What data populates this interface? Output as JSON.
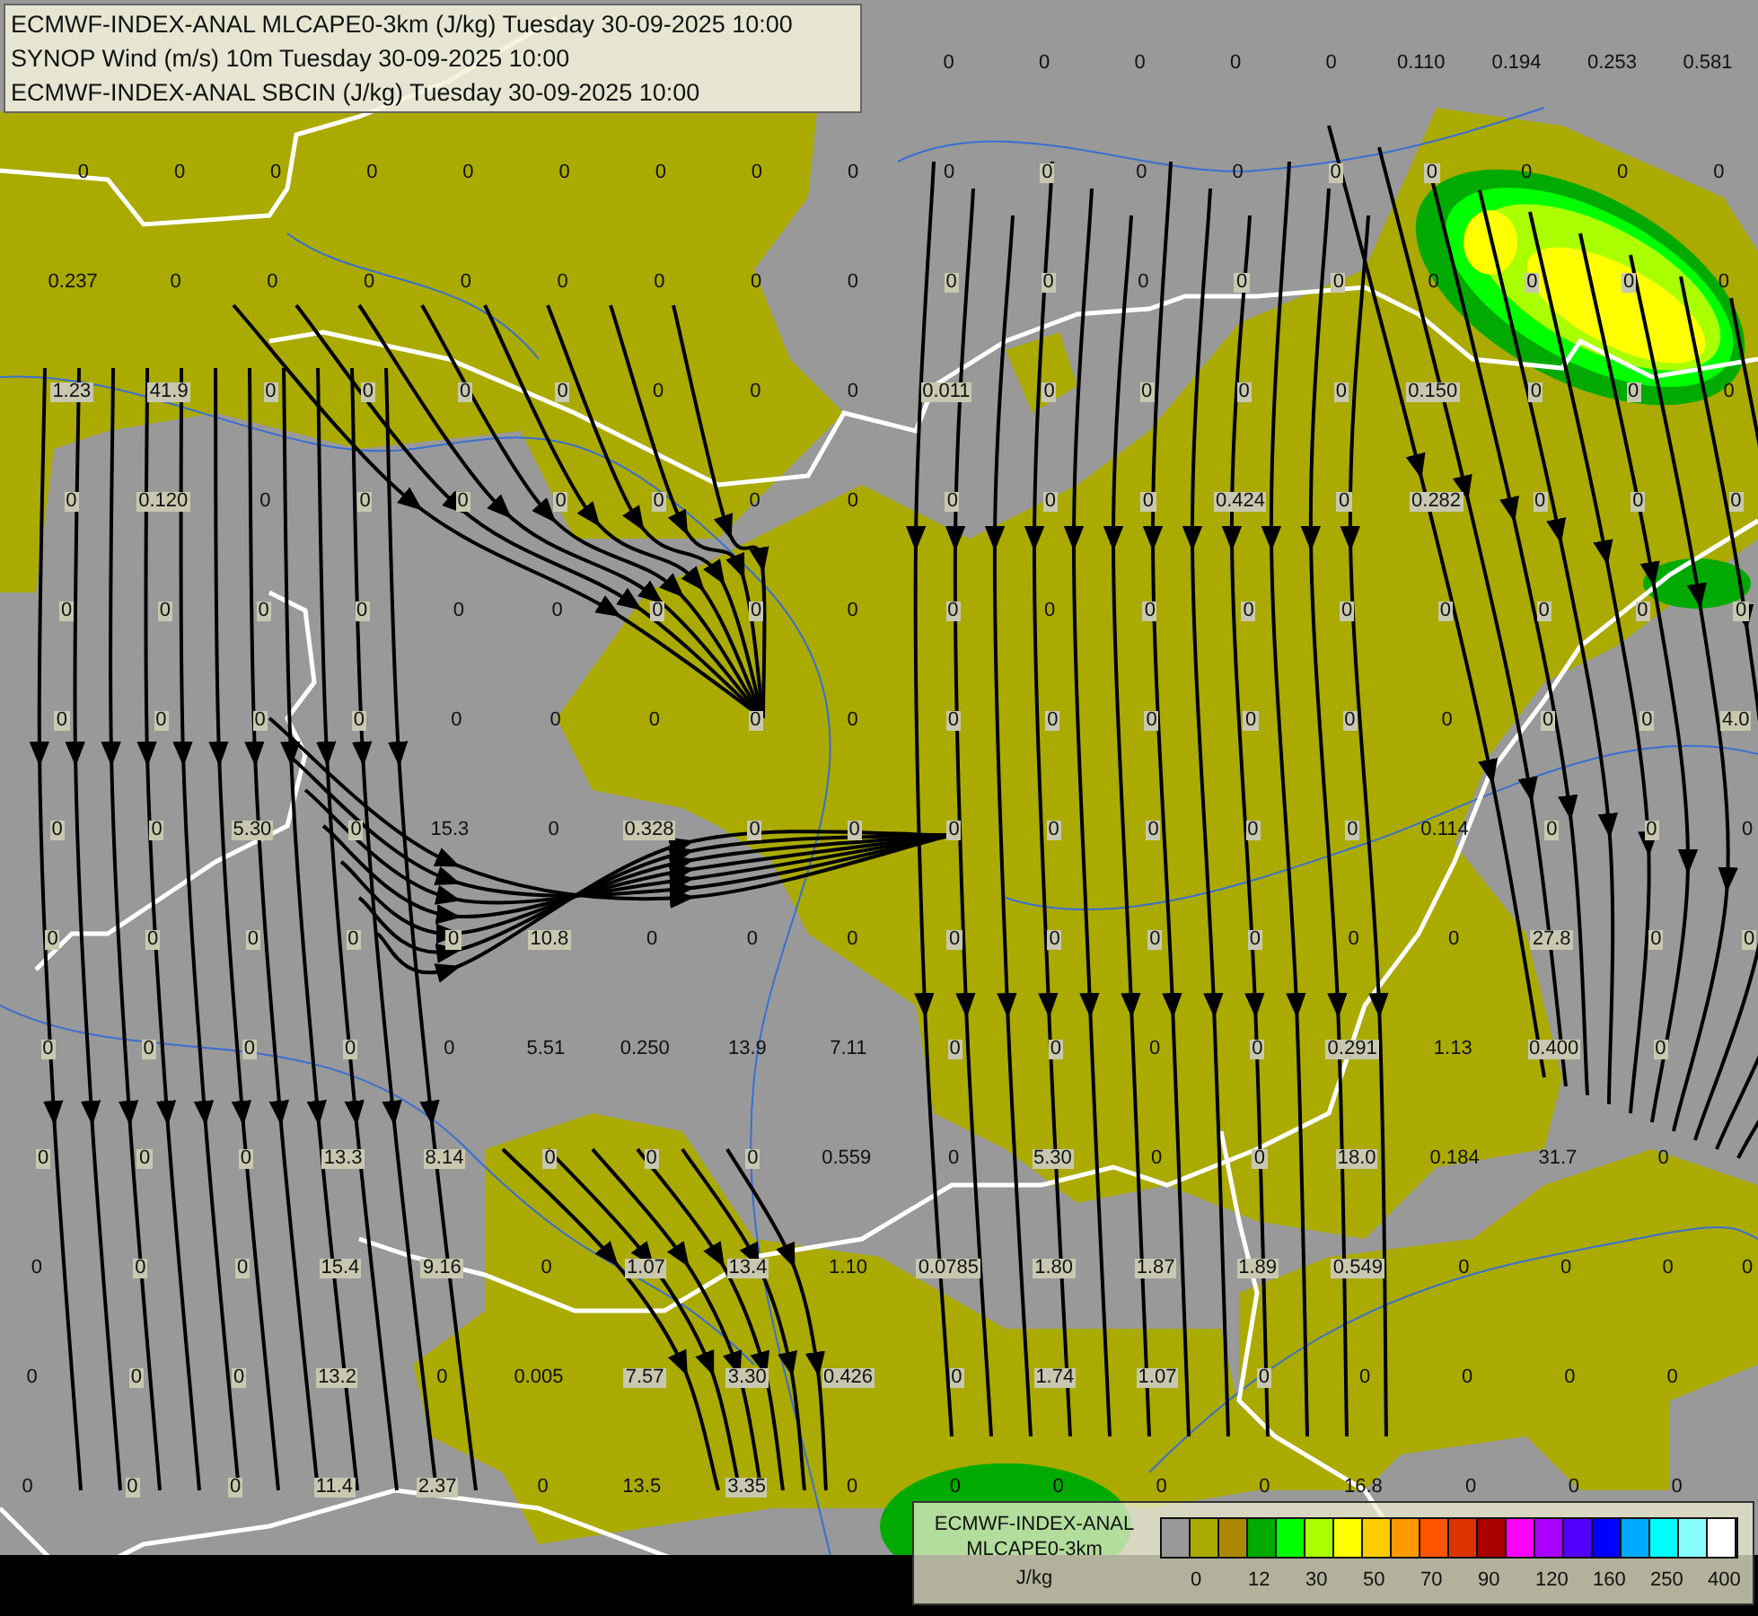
{
  "title_legend": {
    "lines": [
      "ECMWF-INDEX-ANAL MLCAPE0-3km (J/kg) Tuesday 30-09-2025 10:00",
      "SYNOP Wind (m/s) 10m Tuesday 30-09-2025 10:00",
      "ECMWF-INDEX-ANAL SBCIN (J/kg) Tuesday 30-09-2025 10:00"
    ]
  },
  "top_row_values": [
    "0",
    "0",
    "0",
    "0",
    "0",
    "0.110",
    "0.194",
    "0.253",
    "0.581"
  ],
  "station_values": [
    [
      "0",
      "0",
      "0",
      "0",
      "0",
      "0",
      "0",
      "0",
      "0",
      "0",
      "0",
      "0",
      "0",
      "0",
      "0",
      "0",
      "0",
      "0"
    ],
    [
      "0.237",
      "0",
      "0",
      "0",
      "0",
      "0",
      "0",
      "0",
      "0",
      "0",
      "0",
      "0",
      "0",
      "0",
      "0",
      "0",
      "0",
      "0"
    ],
    [
      "1.23",
      "41.9",
      "0",
      "0",
      "0",
      "0",
      "0",
      "0",
      "0",
      "0.011",
      "0",
      "0",
      "0",
      "0",
      "0.150",
      "0",
      "0",
      "0"
    ],
    [
      "0",
      "0.120",
      "0",
      "0",
      "0",
      "0",
      "0",
      "0",
      "0",
      "0",
      "0",
      "0",
      "0.424",
      "0",
      "0.282",
      "0",
      "0",
      "0"
    ],
    [
      "0",
      "0",
      "0",
      "0",
      "0",
      "0",
      "0",
      "0",
      "0",
      "0",
      "0",
      "0",
      "0",
      "0",
      "0",
      "0",
      "0",
      "0"
    ],
    [
      "0",
      "0",
      "0",
      "0",
      "0",
      "0",
      "0",
      "0",
      "0",
      "0",
      "0",
      "0",
      "0",
      "0",
      "0",
      "0",
      "0",
      "4.0"
    ],
    [
      "0",
      "0",
      "5.30",
      "0",
      "15.3",
      "0",
      "0.328",
      "0",
      "0",
      "0",
      "0",
      "0",
      "0",
      "0",
      "0.114",
      "0",
      "0",
      "0"
    ],
    [
      "0",
      "0",
      "0",
      "0",
      "0",
      "10.8",
      "0",
      "0",
      "0",
      "0",
      "0",
      "0",
      "0",
      "0",
      "0",
      "27.8",
      "0",
      "0"
    ],
    [
      "0",
      "0",
      "0",
      "0",
      "0",
      "5.51",
      "0.250",
      "13.9",
      "7.11",
      "0",
      "0",
      "0",
      "0",
      "0.291",
      "1.13",
      "0.400",
      "0"
    ],
    [
      "0",
      "0",
      "0",
      "13.3",
      "8.14",
      "0",
      "0",
      "0",
      "0.559",
      "0",
      "5.30",
      "0",
      "0",
      "18.0",
      "0.184",
      "31.7",
      "0"
    ],
    [
      "0",
      "0",
      "0",
      "15.4",
      "9.16",
      "0",
      "1.07",
      "13.4",
      "1.10",
      "0.0785",
      "1.80",
      "1.87",
      "1.89",
      "0.549",
      "0",
      "0",
      "0",
      "0"
    ],
    [
      "0",
      "0",
      "0",
      "13.2",
      "0",
      "0.005",
      "7.57",
      "3.30",
      "0.426",
      "0",
      "1.74",
      "1.07",
      "0",
      "0",
      "0",
      "0",
      "0"
    ],
    [
      "0",
      "0",
      "0",
      "11.4",
      "2.37",
      "0",
      "13.5",
      "3.35",
      "0",
      "0",
      "0",
      "0",
      "0",
      "16.8",
      "0",
      "0",
      "0"
    ]
  ],
  "color_legend": {
    "title_lines": [
      "ECMWF-INDEX-ANAL",
      "MLCAPE0-3km"
    ],
    "unit": "J/kg",
    "swatches": [
      {
        "color": "#999999"
      },
      {
        "color": "#aaaa00"
      },
      {
        "color": "#aa8800"
      },
      {
        "color": "#00aa00"
      },
      {
        "color": "#00ff00"
      },
      {
        "color": "#aaff00"
      },
      {
        "color": "#ffff00"
      },
      {
        "color": "#ffcc00"
      },
      {
        "color": "#ff9900"
      },
      {
        "color": "#ff5500"
      },
      {
        "color": "#dd3300"
      },
      {
        "color": "#aa0000"
      },
      {
        "color": "#ff00ff"
      },
      {
        "color": "#aa00ff"
      },
      {
        "color": "#5500ff"
      },
      {
        "color": "#0000ff"
      },
      {
        "color": "#00aaff"
      },
      {
        "color": "#00ffff"
      },
      {
        "color": "#88ffff"
      },
      {
        "color": "#ffffff"
      }
    ],
    "tick_labels": [
      "0",
      "12",
      "30",
      "50",
      "70",
      "90",
      "120",
      "160",
      "250",
      "400"
    ]
  }
}
